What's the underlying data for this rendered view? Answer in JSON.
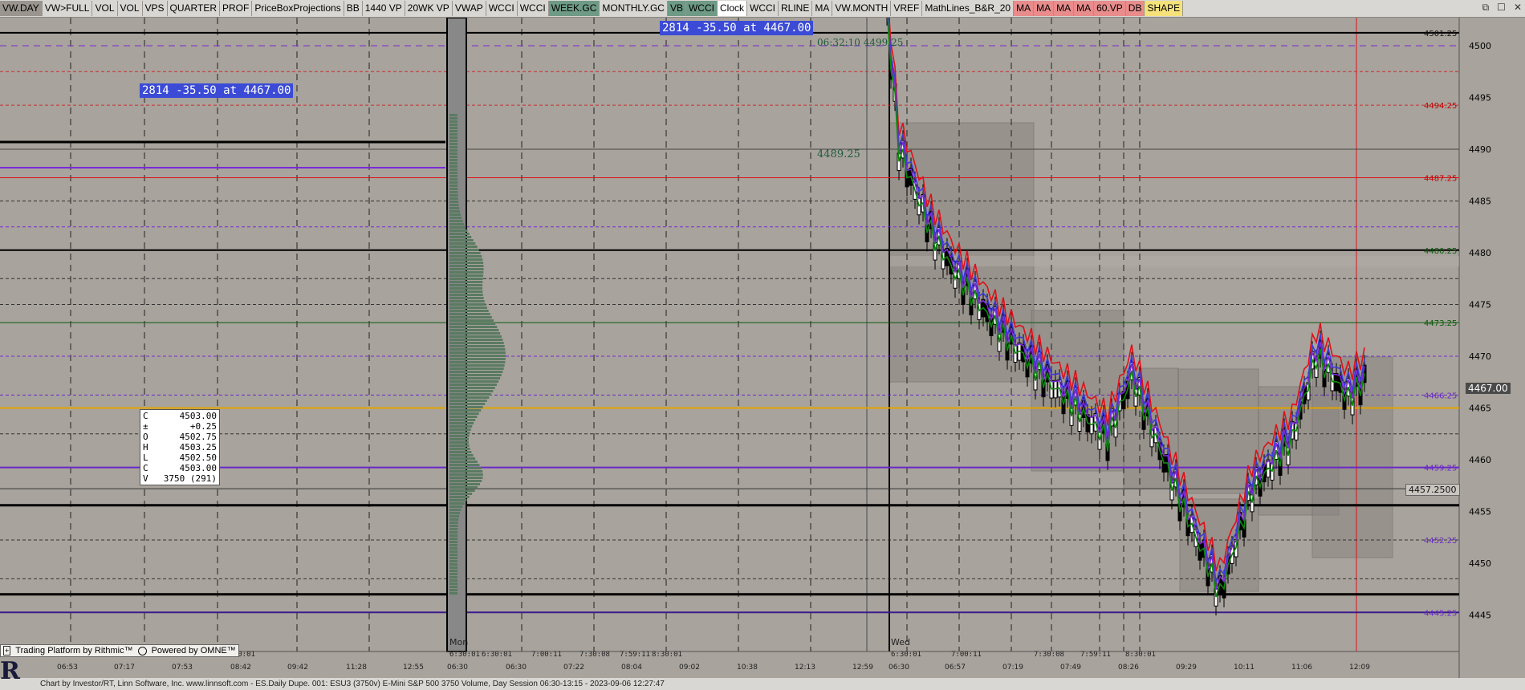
{
  "toolbar": {
    "items": [
      {
        "label": "VW.DAY",
        "bg": "#9a968f"
      },
      {
        "label": "VW>FULL",
        "bg": "#d9d7d3"
      },
      {
        "label": "VOL",
        "bg": "#d9d7d3"
      },
      {
        "label": "VOL",
        "bg": "#d9d7d3"
      },
      {
        "label": "VPS",
        "bg": "#d9d7d3"
      },
      {
        "label": "QUARTER",
        "bg": "#d9d7d3"
      },
      {
        "label": "PROF",
        "bg": "#d9d7d3"
      },
      {
        "label": "PriceBoxProjections",
        "bg": "#d9d7d3"
      },
      {
        "label": "BB",
        "bg": "#d9d7d3"
      },
      {
        "label": "1440 VP",
        "bg": "#d9d7d3"
      },
      {
        "label": "20WK VP",
        "bg": "#d9d7d3"
      },
      {
        "label": "VWAP",
        "bg": "#d9d7d3"
      },
      {
        "label": "WCCI",
        "bg": "#d9d7d3"
      },
      {
        "label": "WCCI",
        "bg": "#d9d7d3"
      },
      {
        "label": "WEEK.GC",
        "bg": "#6e9a86"
      },
      {
        "label": "MONTHLY.GC",
        "bg": "#d9d7d3"
      },
      {
        "label": "VB",
        "bg": "#6e9a86"
      },
      {
        "label": "WCCI",
        "bg": "#6e9a86"
      },
      {
        "label": "Clock",
        "bg": "#ffffff"
      },
      {
        "label": "WCCI",
        "bg": "#d9d7d3"
      },
      {
        "label": "RLINE",
        "bg": "#d9d7d3"
      },
      {
        "label": "MA",
        "bg": "#d9d7d3"
      },
      {
        "label": "VW.MONTH",
        "bg": "#d9d7d3"
      },
      {
        "label": "VREF",
        "bg": "#d9d7d3"
      },
      {
        "label": "MathLines_B&R_20",
        "bg": "#d9d7d3"
      },
      {
        "label": "MA",
        "bg": "#e88c8c"
      },
      {
        "label": "MA",
        "bg": "#e88c8c"
      },
      {
        "label": "MA",
        "bg": "#e88c8c"
      },
      {
        "label": "MA",
        "bg": "#e88c8c"
      },
      {
        "label": "60.VP",
        "bg": "#e88c8c"
      },
      {
        "label": "DB",
        "bg": "#e88c8c"
      },
      {
        "label": "SHAPE",
        "bg": "#f5e27a"
      }
    ],
    "window_controls": [
      "restore-icon",
      "maximize-icon",
      "close-icon"
    ]
  },
  "chart": {
    "price_axis": [
      "4500",
      "4495",
      "4490",
      "4485",
      "4480",
      "4475",
      "4470",
      "4465",
      "4460",
      "4455",
      "4450",
      "4445"
    ],
    "price_labels": [
      {
        "text": "4501.25",
        "color": "#111111"
      },
      {
        "text": "4494.25",
        "color": "#c00000"
      },
      {
        "text": "4487.25",
        "color": "#c00000"
      },
      {
        "text": "4480.25",
        "color": "#0a5a0a"
      },
      {
        "text": "4473.25",
        "color": "#0a5a0a"
      },
      {
        "text": "4466.25",
        "color": "#6a28c8"
      },
      {
        "text": "4459.25",
        "color": "#6a28c8"
      },
      {
        "text": "4452.25",
        "color": "#6a28c8"
      },
      {
        "text": "4445.25",
        "color": "#6a28c8"
      }
    ],
    "current_price": "4467.00",
    "marker_price": "4457.2500",
    "badge_top": "2814  -35.50 at 4467.00",
    "badge_left": "2814  -35.50 at 4467.00",
    "level_4489": "4489.25",
    "time_note": "06:32:10  4499.25",
    "ohlc": [
      {
        "k": "C",
        "v": "4503.00"
      },
      {
        "k": "±",
        "v": "+0.25"
      },
      {
        "k": "O",
        "v": "4502.75"
      },
      {
        "k": "H",
        "v": "4503.25"
      },
      {
        "k": "L",
        "v": "4502.50"
      },
      {
        "k": "C",
        "v": "4503.00"
      },
      {
        "k": "V",
        "v": "3750  (291)"
      }
    ],
    "time_axis": [
      "06:53",
      "07:17",
      "07:53",
      "08:42",
      "09:42",
      "11:28",
      "12:55",
      "06:30",
      "06:30",
      "07:22",
      "08:04",
      "09:02",
      "10:38",
      "12:13",
      "12:59",
      "06:30",
      "06:57",
      "07:19",
      "07:49",
      "08:26",
      "09:29",
      "10:11",
      "11:06",
      "12:09"
    ],
    "session_labels": [
      "Mon",
      "Wed"
    ],
    "session_tags": [
      "6:30:01",
      "6:30:01",
      "6:30:01",
      "7:00:11",
      "7:30:08",
      "7:59:11",
      "8:30:01",
      "6:30:01",
      "7:00:11",
      "7:30:08",
      "7:59:11",
      "8:30:01"
    ]
  },
  "footer": {
    "left_a": "Trading Platform by Rithmic™",
    "left_b": "Powered by OMNE™",
    "status": "Chart by Investor/RT, Linn Software, Inc. www.linnsoft.com - ES.Daily Dupe.  001: ESU3 (3750v) E-Mini S&P 500 3750 Volume, Day Session 06:30-13:15 - 2023-09-06 12:27:47"
  },
  "colors": {
    "bg": "#a8a39c",
    "red": "#e0101a",
    "green": "#0a8a0a",
    "blue": "#3a3ad6",
    "purple": "#7a2ad6",
    "gold": "#e2a400"
  }
}
